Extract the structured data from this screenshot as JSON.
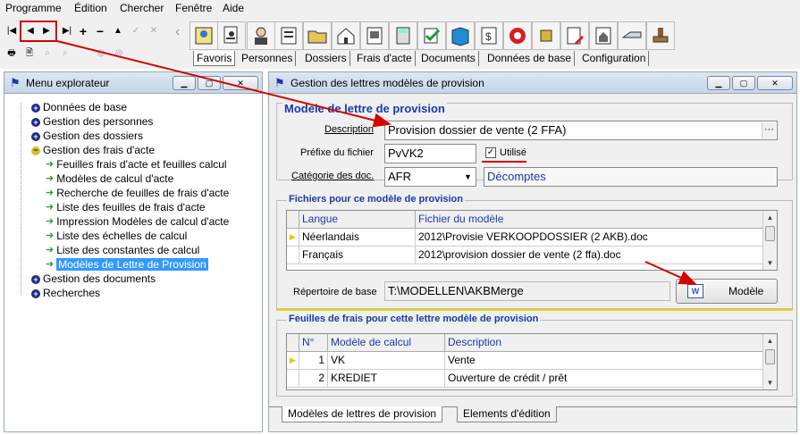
{
  "menubar": {
    "items": [
      "Programme",
      "Édition",
      "Chercher",
      "Fenêtre",
      "Aide"
    ]
  },
  "toolbar": {
    "nav_buttons": [
      "first-icon",
      "prev-icon",
      "next-icon",
      "last-icon",
      "add-icon",
      "remove-icon",
      "up-icon",
      "check-icon",
      "cancel-icon"
    ],
    "tools": [
      "settings-people-icon",
      "report-icon",
      "person-icon",
      "file-doc-icon",
      "folder-icon",
      "home-icon",
      "calc-doc-icon",
      "calculator-icon",
      "check-doc-icon",
      "book-icon",
      "money-doc-icon",
      "lifebuoy-icon",
      "chip-icon",
      "pencil-doc-icon",
      "house-doc-icon",
      "hand-doc-icon",
      "stamp-icon"
    ],
    "tabs": [
      "Favoris",
      "Personnes",
      "Dossiers",
      "Frais d'acte",
      "Documents",
      "Données de base",
      "Configuration"
    ]
  },
  "explorer": {
    "title": "Menu explorateur",
    "tree": [
      {
        "label": "Données de base",
        "kind": "plus"
      },
      {
        "label": "Gestion des personnes",
        "kind": "plus"
      },
      {
        "label": "Gestion des dossiers",
        "kind": "plus"
      },
      {
        "label": "Gestion des frais d'acte",
        "kind": "minus"
      },
      {
        "label": "Feuilles frais d'acte et feuilles calcul",
        "kind": "leaf"
      },
      {
        "label": "Modèles de calcul d'acte",
        "kind": "leaf"
      },
      {
        "label": "Recherche de feuilles de frais d'acte",
        "kind": "leaf"
      },
      {
        "label": "Liste des feuilles de frais d'acte",
        "kind": "leaf"
      },
      {
        "label": "Impression Modèles de calcul d'acte",
        "kind": "leaf"
      },
      {
        "label": "Liste des échelles de calcul",
        "kind": "leaf"
      },
      {
        "label": "Liste des constantes de calcul",
        "kind": "leaf"
      },
      {
        "label": "Modèles de Lettre de Provision",
        "kind": "leaf-selected"
      },
      {
        "label": "Gestion des documents",
        "kind": "plus"
      },
      {
        "label": "Recherches",
        "kind": "plus"
      }
    ]
  },
  "form": {
    "window_title": "Gestion des lettres modèles de provision",
    "section_title": "Modèle de lettre de provision",
    "description_label": "Description",
    "description_value": "Provision dossier de vente (2 FFA)",
    "prefix_label": "Préfixe du fichier",
    "prefix_value": "PvVK2",
    "used_label": "Utilisé",
    "category_label": "Catégorie des doc.",
    "category_value": "AFR",
    "category_desc": "Décomptes",
    "files_section": "Fichiers pour ce modèle de provision",
    "files_columns": [
      "Langue",
      "Fichier du modèle"
    ],
    "files_rows": [
      [
        "Néerlandais",
        "2012\\Provisie VERKOOPDOSSIER (2 AKB).doc"
      ],
      [
        "Français",
        "2012\\provision dossier de vente (2 ffa).doc"
      ]
    ],
    "base_dir_label": "Répertoire de base",
    "base_dir_value": "T:\\MODELLEN\\AKBMerge",
    "model_button": "Modèle",
    "sheets_section": "Feuilles de frais pour cette lettre modèle de provision",
    "sheets_columns": [
      "N°",
      "Modèle de calcul",
      "Description"
    ],
    "sheets_rows": [
      [
        "1",
        "VK",
        "Vente"
      ],
      [
        "2",
        "KREDIET",
        "Ouverture de crédit / prêt"
      ]
    ],
    "bottom_tabs": [
      "Modèles de lettres de provision",
      "Elements d'édition"
    ]
  },
  "colors": {
    "highlight_red": "#d40000",
    "selection": "#3399ff",
    "section_title": "#1a3aa8"
  }
}
